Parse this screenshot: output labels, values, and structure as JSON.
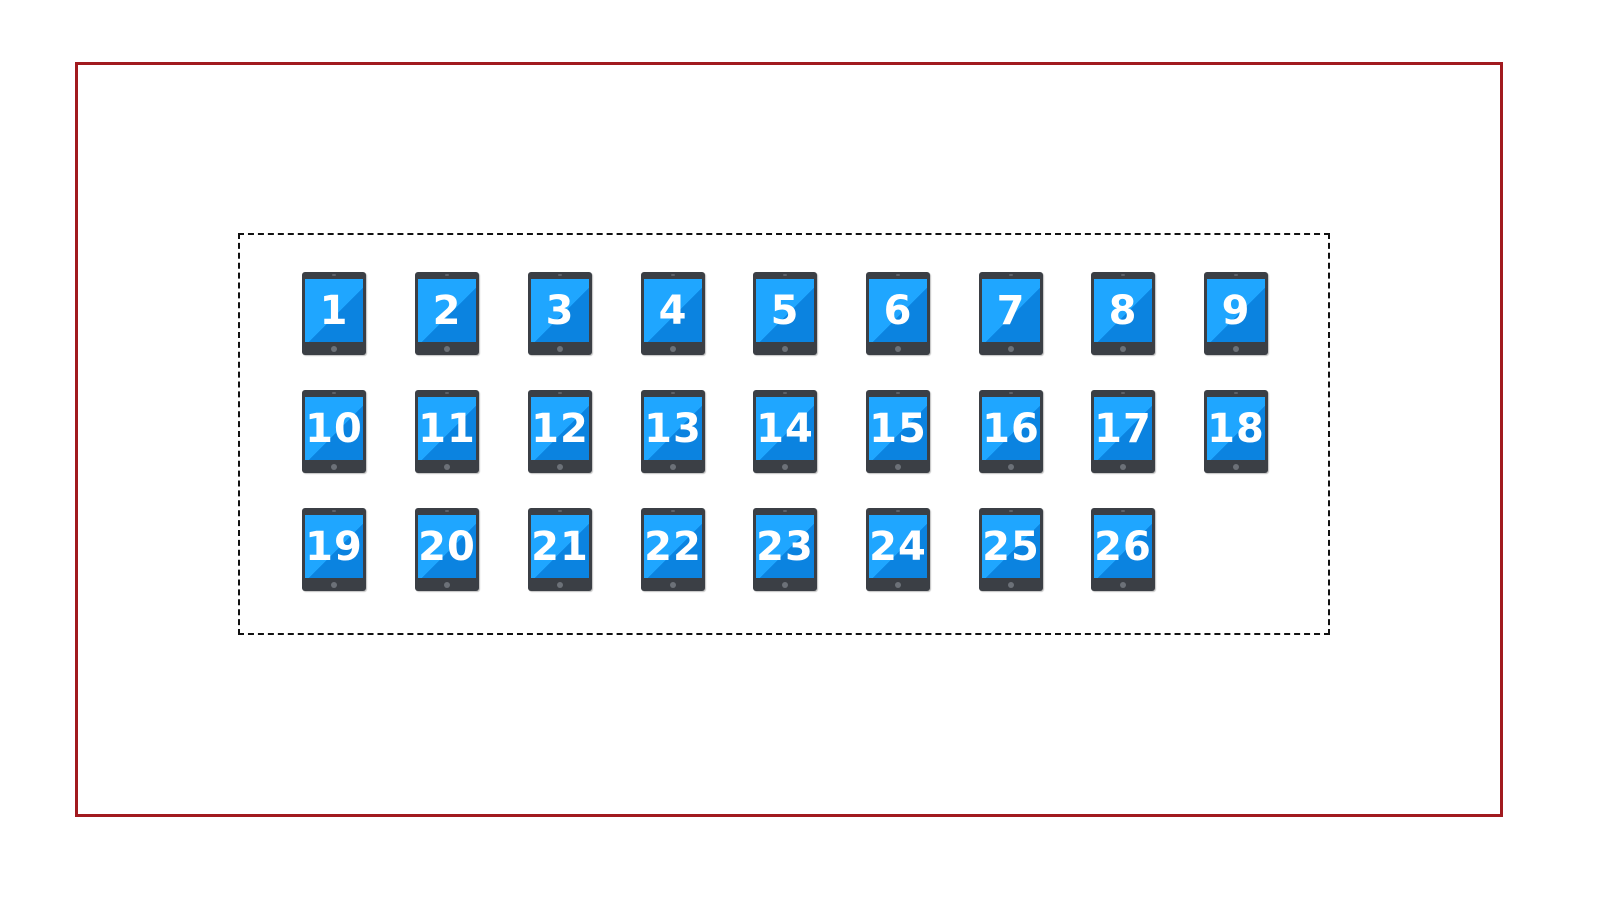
{
  "devices": [
    "1",
    "2",
    "3",
    "4",
    "5",
    "6",
    "7",
    "8",
    "9",
    "10",
    "11",
    "12",
    "13",
    "14",
    "15",
    "16",
    "17",
    "18",
    "19",
    "20",
    "21",
    "22",
    "23",
    "24",
    "25",
    "26"
  ],
  "icon": "tablet-icon",
  "colors": {
    "outer_frame": "#a11a1f",
    "dashed_group": "#111111",
    "device_body": "#3b3f45",
    "device_screen": "#1fa6ff",
    "label": "#ffffff"
  }
}
